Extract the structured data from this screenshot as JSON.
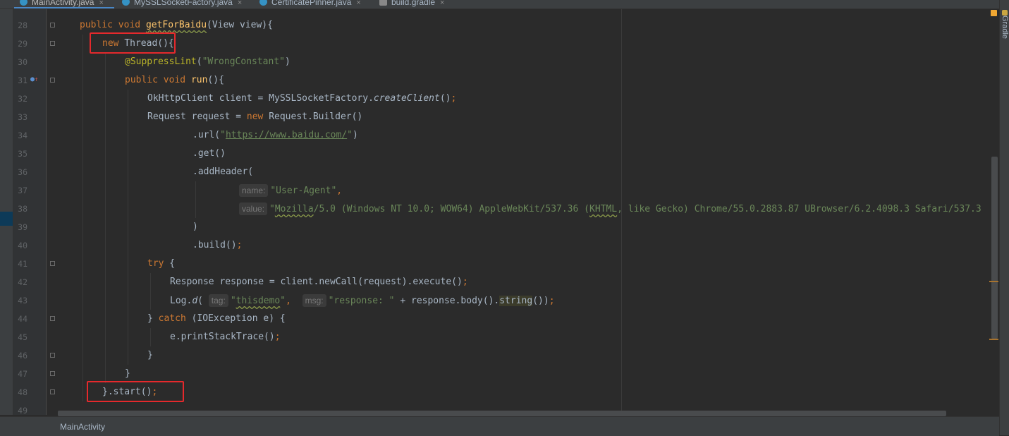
{
  "tabs": [
    {
      "label": "MainActivity.java",
      "close": "×",
      "active": true
    },
    {
      "label": "MySSLSocketFactory.java",
      "close": "×"
    },
    {
      "label": "CertificatePinner.java",
      "close": "×"
    },
    {
      "label": "build.gradle",
      "close": "×"
    }
  ],
  "right_panel": {
    "label": "Gradle"
  },
  "breadcrumb": "MainActivity",
  "line_numbers": [
    "28",
    "29",
    "30",
    "31",
    "32",
    "33",
    "34",
    "35",
    "36",
    "37",
    "38",
    "39",
    "40",
    "41",
    "42",
    "43",
    "44",
    "45",
    "46",
    "47",
    "48",
    "49"
  ],
  "code": {
    "l28": {
      "kw1": "public",
      "kw2": "void",
      "fn": "getForBaidu",
      "rest": "(View view){"
    },
    "l29": {
      "kw": "new",
      "rest": "Thread(){"
    },
    "l30": {
      "ann": "@SuppressLint",
      "p1": "(",
      "str": "\"WrongConstant\"",
      "p2": ")"
    },
    "l31": {
      "kw1": "public",
      "kw2": "void",
      "fn": "run",
      "rest": "(){"
    },
    "l32": {
      "a": "OkHttpClient client = MySSLSocketFactory.",
      "it": "createClient",
      "b": "()",
      "semi": ";"
    },
    "l33": {
      "a": "Request request = ",
      "kw": "new",
      "b": " Request.Builder()"
    },
    "l34": {
      "a": ".url(",
      "q1": "\"",
      "url": "https://www.baidu.com/",
      "q2": "\"",
      "b": ")"
    },
    "l35": {
      "a": ".get()"
    },
    "l36": {
      "a": ".addHeader("
    },
    "l37": {
      "hint": "name:",
      "str": "\"User-Agent\"",
      "comma": ","
    },
    "l38": {
      "hint": "value:",
      "q": "\"",
      "moz": "Mozilla",
      "s1": "/5.0 (Windows NT 10.0; WOW64) AppleWebKit/537.36 (",
      "khtml": "KHTML",
      "s2": ", like Gecko) Chrome/55.0.2883.87 UBrowser/6.2.4098.3 Safari/537.3"
    },
    "l39": {
      "a": ")"
    },
    "l40": {
      "a": ".build()",
      "semi": ";"
    },
    "l41": {
      "kw": "try",
      "b": " {"
    },
    "l42": {
      "a": "Response response = client.newCall(request).execute()",
      "semi": ";"
    },
    "l43": {
      "a": "Log.",
      "it": "d",
      "p": "(",
      "hint1": "tag:",
      "q1": "\"",
      "tag": "thisdemo",
      "q2": "\"",
      "comma": ",",
      "hint2": "msg:",
      "str": "\"response: \"",
      "b": " + response.body().",
      "hl": "string",
      "c": "())",
      "semi": ";"
    },
    "l44": {
      "a": "} ",
      "kw": "catch",
      "b": " (IOException e) {"
    },
    "l45": {
      "a": "e.printStackTrace()",
      "semi": ";"
    },
    "l46": {
      "a": "}"
    },
    "l47": {
      "a": "}"
    },
    "l48": {
      "a": "}.start()",
      "semi": ";"
    }
  },
  "colors": {
    "background": "#2b2b2b",
    "keyword": "#cc7832",
    "function": "#ffc66d",
    "string": "#6a8759",
    "annotation": "#bbb529",
    "highlight_box": "#e5292c"
  }
}
